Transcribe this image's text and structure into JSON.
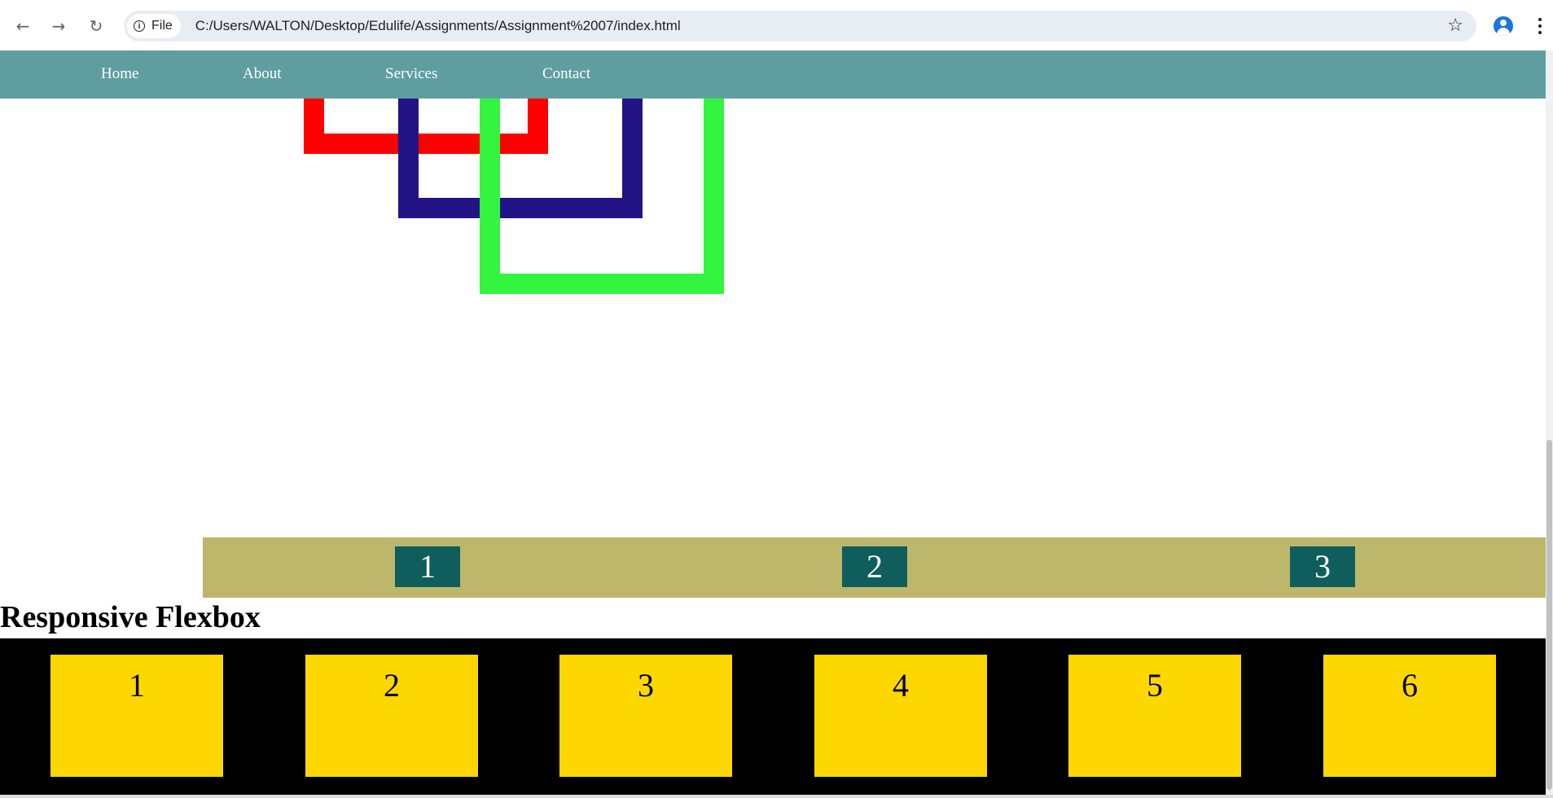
{
  "browser": {
    "back_icon": "arrow-left-icon",
    "forward_icon": "arrow-right-icon",
    "reload_icon": "reload-icon",
    "chip_label": "File",
    "url": "C:/Users/WALTON/Desktop/Edulife/Assignments/Assignment%2007/index.html"
  },
  "nav": {
    "items": [
      {
        "label": "Home"
      },
      {
        "label": "About"
      },
      {
        "label": "Services"
      },
      {
        "label": "Contact"
      }
    ],
    "background": "#5f9ea0"
  },
  "boxes": {
    "red": "#ff0000",
    "navy": "#221487",
    "green": "#33f53f"
  },
  "olive_row": {
    "background": "#bdb76b",
    "item_color": "#0e5e5e",
    "items": [
      "1",
      "2",
      "3"
    ]
  },
  "responsive": {
    "title": "Responsive Flexbox",
    "background": "#000000",
    "item_color": "#ffd700",
    "items": [
      "1",
      "2",
      "3",
      "4",
      "5",
      "6"
    ]
  }
}
